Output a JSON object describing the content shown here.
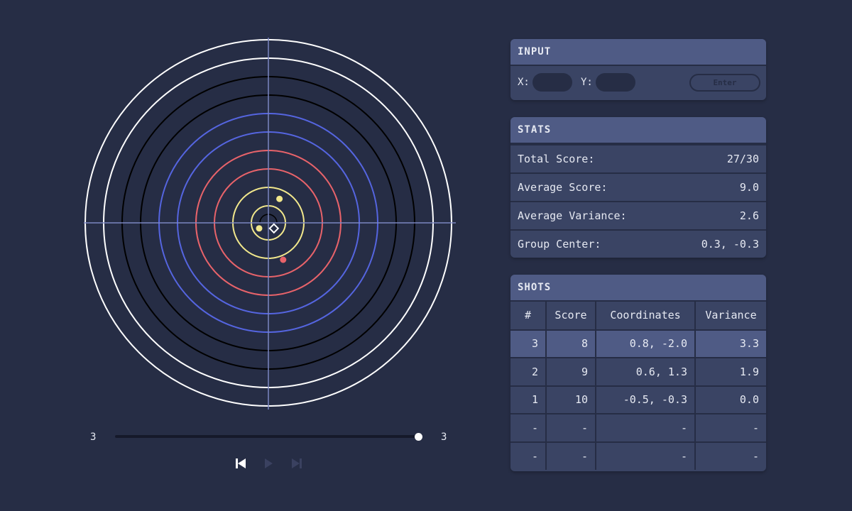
{
  "input": {
    "title": "INPUT",
    "x_label": "X:",
    "y_label": "Y:",
    "x_value": "",
    "y_value": "",
    "enter_label": "Enter"
  },
  "stats": {
    "title": "STATS",
    "rows": [
      {
        "label": "Total Score:",
        "value": "27/30"
      },
      {
        "label": "Average Score:",
        "value": "9.0"
      },
      {
        "label": "Average Variance:",
        "value": "2.6"
      },
      {
        "label": "Group Center:",
        "value": "0.3, -0.3"
      }
    ]
  },
  "shots": {
    "title": "SHOTS",
    "columns": [
      "#",
      "Score",
      "Coordinates",
      "Variance"
    ],
    "rows": [
      {
        "idx": "3",
        "score": "8",
        "coords": "0.8, -2.0",
        "variance": "3.3",
        "selected": true
      },
      {
        "idx": "2",
        "score": "9",
        "coords": "0.6, 1.3",
        "variance": "1.9",
        "selected": false
      },
      {
        "idx": "1",
        "score": "10",
        "coords": "-0.5, -0.3",
        "variance": "0.0",
        "selected": false
      },
      {
        "idx": "-",
        "score": "-",
        "coords": "-",
        "variance": "-",
        "selected": false
      },
      {
        "idx": "-",
        "score": "-",
        "coords": "-",
        "variance": "-",
        "selected": false
      }
    ]
  },
  "playback": {
    "min_label": "3",
    "max_label": "3",
    "position_fraction": 1.0
  },
  "target": {
    "shots": [
      {
        "x": 0.8,
        "y": -2.0,
        "color": "#e8636a"
      },
      {
        "x": 0.6,
        "y": 1.3,
        "color": "#f2e88c"
      },
      {
        "x": -0.5,
        "y": -0.3,
        "color": "#f2e88c"
      }
    ],
    "group_center": {
      "x": 0.3,
      "y": -0.3
    },
    "ring_colors": [
      "#f2e88c",
      "#f2e88c",
      "#e8636a",
      "#e8636a",
      "#5565e0",
      "#5565e0",
      "#000000",
      "#000000",
      "#ffffff",
      "#ffffff"
    ],
    "crosshair_color": "#7b86c2",
    "background": "#262d45"
  }
}
